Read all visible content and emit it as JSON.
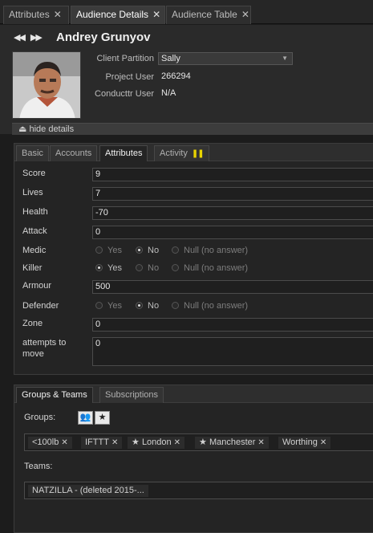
{
  "top_tabs": [
    {
      "label": "Attributes",
      "active": false
    },
    {
      "label": "Audience Details",
      "active": true
    },
    {
      "label": "Audience Table",
      "active": false
    }
  ],
  "profile": {
    "name": "Andrey Grunyov",
    "client_partition_label": "Client Partition",
    "client_partition_value": "Sally",
    "project_user_label": "Project User",
    "project_user_value": "266294",
    "conducttr_user_label": "Conducttr User",
    "conducttr_user_value": "N/A",
    "hide_details": "hide details"
  },
  "attr_tabs": [
    {
      "label": "Basic",
      "active": false
    },
    {
      "label": "Accounts",
      "active": false
    },
    {
      "label": "Attributes",
      "active": true
    },
    {
      "label": "Activity",
      "active": false
    }
  ],
  "attributes": {
    "score": {
      "label": "Score",
      "value": "9"
    },
    "lives": {
      "label": "Lives",
      "value": "7"
    },
    "health": {
      "label": "Health",
      "value": "-70"
    },
    "attack": {
      "label": "Attack",
      "value": "0"
    },
    "medic": {
      "label": "Medic",
      "selected": "No"
    },
    "killer": {
      "label": "Killer",
      "selected": "Yes"
    },
    "armour": {
      "label": "Armour",
      "value": "500"
    },
    "defender": {
      "label": "Defender",
      "selected": "No"
    },
    "zone": {
      "label": "Zone",
      "value": "0"
    },
    "attempts": {
      "label": "attempts to move",
      "value": "0"
    }
  },
  "radio_options": {
    "yes": "Yes",
    "no": "No",
    "null": "Null (no answer)"
  },
  "group_tabs": [
    {
      "label": "Groups & Teams",
      "active": true
    },
    {
      "label": "Subscriptions",
      "active": false
    }
  ],
  "groups": {
    "label": "Groups:",
    "tags": [
      "<100lb",
      "IFTTT",
      "London",
      "Manchester",
      "Worthing"
    ]
  },
  "teams": {
    "label": "Teams:",
    "tags": [
      "NATZILLA - (deleted 2015-..."
    ]
  },
  "colors": {
    "background": "#1c1c1c",
    "panel": "#242424",
    "accent_pause": "#e8d400"
  }
}
